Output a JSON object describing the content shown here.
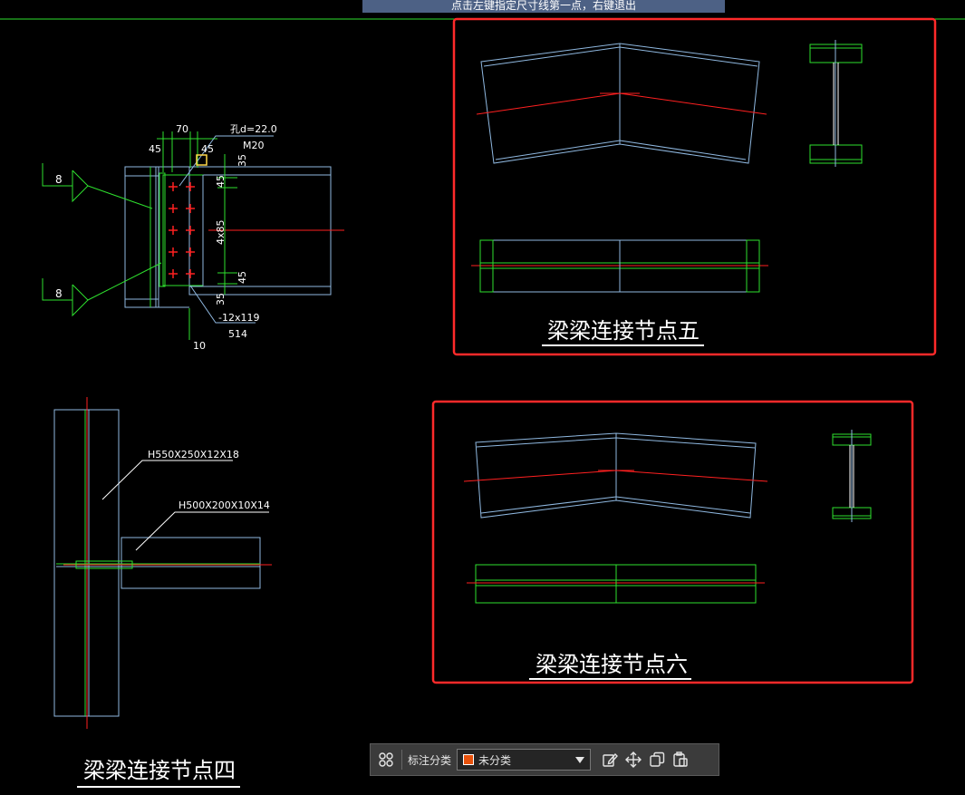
{
  "prompt_text": "点击左键指定尺寸线第一点，右键退出",
  "colors": {
    "background": "#000000",
    "line_cyan": "#8fb8e0",
    "line_green": "#2ee02e",
    "line_red": "#ff2020",
    "frame_red": "#ff2a2a",
    "title_white": "#ffffff"
  },
  "drawings": {
    "node4_title": "梁梁连接节点四",
    "node5_title": "梁梁连接节点五",
    "node6_title": "梁梁连接节点六"
  },
  "detail_top_left": {
    "dim_70": "70",
    "dim_45_left": "45",
    "dim_45_right": "45",
    "hole_note": "孔d=22.0",
    "bolt_note": "M20",
    "dim_35_top": "35",
    "dim_45_upper": "45",
    "dim_4x85": "4x85",
    "dim_45_lower": "45",
    "dim_35_bottom": "35",
    "plate_note": "-12x119",
    "plate_length": "514",
    "dim_10": "10",
    "weld_symbol_upper": "8",
    "weld_symbol_lower": "8"
  },
  "detail_bottom_left": {
    "column_section": "H550X250X12X18",
    "beam_section": "H500X200X10X14"
  },
  "toolbar": {
    "grid_icon": "apps-icon",
    "label": "标注分类",
    "category_value": "未分类",
    "category_color": "#e8520c",
    "edit_icon": "edit-icon",
    "move_icon": "move-icon",
    "copy_icon": "copy-icon",
    "paste_icon": "paste-icon"
  }
}
